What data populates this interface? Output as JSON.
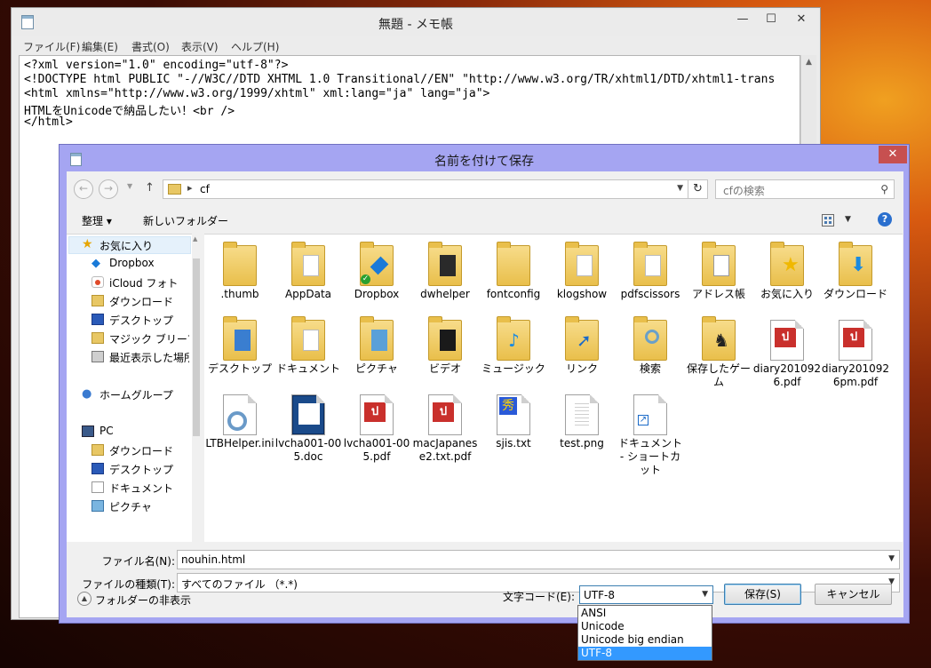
{
  "notepad": {
    "title": "無題 - メモ帳",
    "menus": [
      "ファイル(F)",
      "編集(E)",
      "書式(O)",
      "表示(V)",
      "ヘルプ(H)"
    ],
    "lines": [
      "<?xml version=\"1.0\" encoding=\"utf-8\"?>",
      "<!DOCTYPE html PUBLIC \"-//W3C//DTD XHTML 1.0 Transitional//EN\" \"http://www.w3.org/TR/xhtml1/DTD/xhtml1-trans",
      "<html xmlns=\"http://www.w3.org/1999/xhtml\" xml:lang=\"ja\" lang=\"ja\">",
      "HTMLをUnicodeで納品したい！<br />",
      "</html>"
    ],
    "controls": {
      "minimize": "—",
      "maximize": "☐",
      "close": "✕"
    }
  },
  "dialog": {
    "title": "名前を付けて保存",
    "close": "✕",
    "address": {
      "path": "cf"
    },
    "search_placeholder": "cfの検索",
    "toolbar": {
      "organize": "整理 ▾",
      "new_folder": "新しいフォルダー",
      "help": "?"
    },
    "nav": [
      {
        "label": "お気に入り",
        "icon": "star"
      },
      {
        "label": "Dropbox",
        "icon": "dropbox"
      },
      {
        "label": "iCloud フォト",
        "icon": "icloud"
      },
      {
        "label": "ダウンロード",
        "icon": "folder"
      },
      {
        "label": "デスクトップ",
        "icon": "desktop"
      },
      {
        "label": "マジック ブリーフケース",
        "icon": "folder"
      },
      {
        "label": "最近表示した場所",
        "icon": "recent"
      },
      {
        "label": "ホームグループ",
        "icon": "homegroup"
      },
      {
        "label": "PC",
        "icon": "pc"
      },
      {
        "label": "ダウンロード",
        "icon": "folder"
      },
      {
        "label": "デスクトップ",
        "icon": "desktop"
      },
      {
        "label": "ドキュメント",
        "icon": "document"
      },
      {
        "label": "ピクチャ",
        "icon": "picture"
      }
    ],
    "files": [
      {
        "label": ".thumb",
        "kind": "folder"
      },
      {
        "label": "AppData",
        "kind": "folder-paper"
      },
      {
        "label": "Dropbox",
        "kind": "folder-dropbox"
      },
      {
        "label": "dwhelper",
        "kind": "folder-dark"
      },
      {
        "label": "fontconfig",
        "kind": "folder"
      },
      {
        "label": "klogshow",
        "kind": "folder-paper"
      },
      {
        "label": "pdfscissors",
        "kind": "folder-paper"
      },
      {
        "label": "アドレス帳",
        "kind": "folder-address"
      },
      {
        "label": "お気に入り",
        "kind": "folder-star"
      },
      {
        "label": "ダウンロード",
        "kind": "folder-arrow"
      },
      {
        "label": "デスクトップ",
        "kind": "folder-blue"
      },
      {
        "label": "ドキュメント",
        "kind": "folder-paper"
      },
      {
        "label": "ピクチャ",
        "kind": "folder-pic"
      },
      {
        "label": "ビデオ",
        "kind": "folder-video"
      },
      {
        "label": "ミュージック",
        "kind": "folder-music"
      },
      {
        "label": "リンク",
        "kind": "folder-link"
      },
      {
        "label": "検索",
        "kind": "folder-search"
      },
      {
        "label": "保存したゲーム",
        "kind": "folder-chess"
      },
      {
        "label": "diary2010926.pdf",
        "kind": "pdf"
      },
      {
        "label": "diary2010926pm.pdf",
        "kind": "pdf"
      },
      {
        "label": "LTBHelper.ini",
        "kind": "ini"
      },
      {
        "label": "lvcha001-005.doc",
        "kind": "doc"
      },
      {
        "label": "lvcha001-005.pdf",
        "kind": "pdf"
      },
      {
        "label": "macJapanese2.txt.pdf",
        "kind": "pdf"
      },
      {
        "label": "sjis.txt",
        "kind": "sjis"
      },
      {
        "label": "test.png",
        "kind": "png"
      },
      {
        "label": "ドキュメント - ショートカット",
        "kind": "shortcut"
      }
    ],
    "filename_label": "ファイル名(N):",
    "filename_value": "nouhin.html",
    "filetype_label": "ファイルの種類(T):",
    "filetype_value": "すべてのファイル （*.*)",
    "hide_folders": "フォルダーの非表示",
    "encoding_label": "文字コード(E):",
    "encoding_value": "UTF-8",
    "encoding_options": [
      "ANSI",
      "Unicode",
      "Unicode big endian",
      "UTF-8"
    ],
    "encoding_selected_index": 3,
    "save_button": "保存(S)",
    "cancel_button": "キャンセル"
  }
}
